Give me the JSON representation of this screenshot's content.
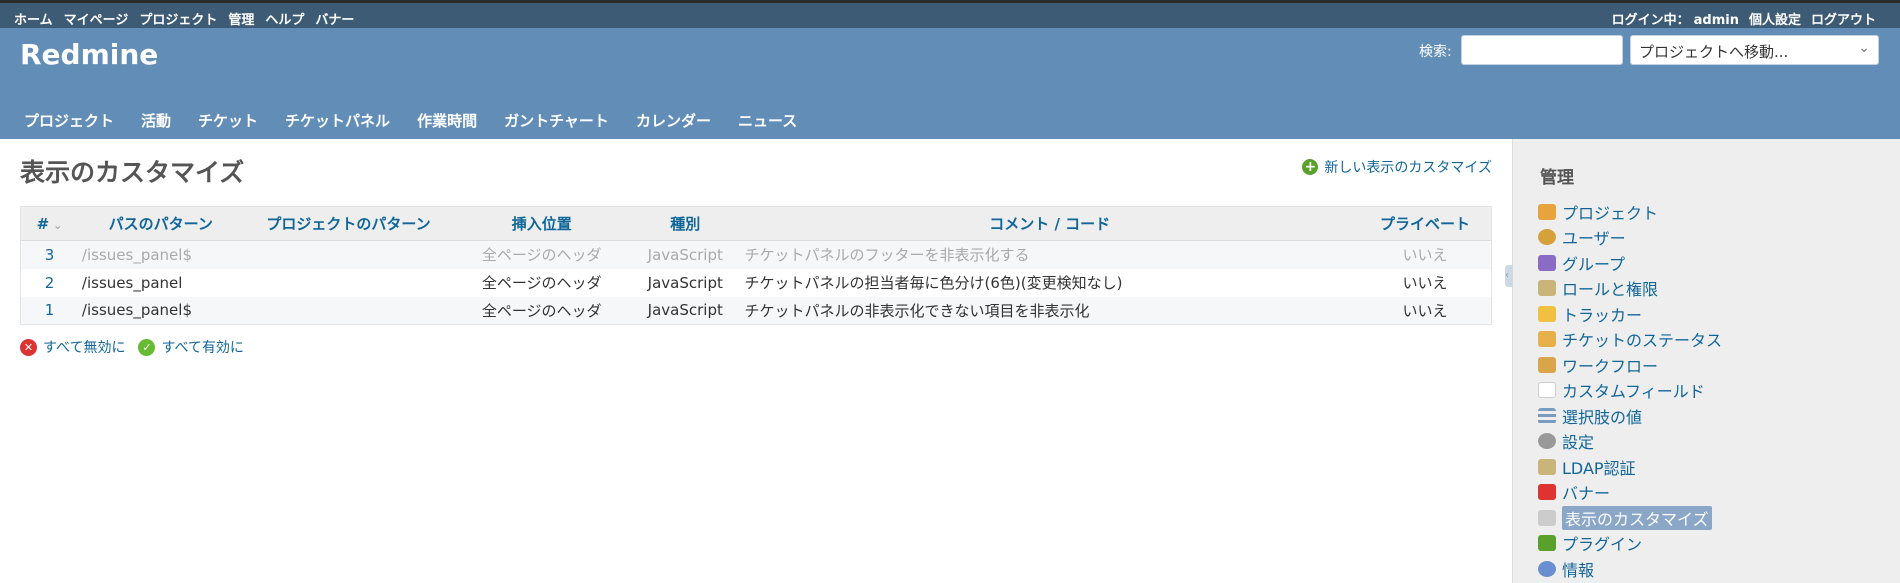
{
  "top_menu": {
    "items": [
      "ホーム",
      "マイページ",
      "プロジェクト",
      "管理",
      "ヘルプ",
      "バナー"
    ],
    "logged_as_label": "ログイン中：",
    "user": "admin",
    "my_account": "個人設定",
    "logout": "ログアウト"
  },
  "header": {
    "title": "Redmine",
    "search_label": "検索:",
    "search_value": "",
    "jump_placeholder": "プロジェクトへ移動..."
  },
  "main_menu": [
    "プロジェクト",
    "活動",
    "チケット",
    "チケットパネル",
    "作業時間",
    "ガントチャート",
    "カレンダー",
    "ニュース"
  ],
  "content": {
    "title": "表示のカスタマイズ",
    "new_link": "新しい表示のカスタマイズ",
    "table": {
      "headers": [
        "#",
        "パスのパターン",
        "プロジェクトのパターン",
        "挿入位置",
        "種別",
        "コメント / コード",
        "プライベート"
      ],
      "rows": [
        {
          "id": "3",
          "path": "/issues_panel$",
          "project": "",
          "position": "全ページのヘッダ",
          "type": "JavaScript",
          "comment": "チケットパネルのフッターを非表示化する",
          "private": "いいえ",
          "disabled": true
        },
        {
          "id": "2",
          "path": "/issues_panel",
          "project": "",
          "position": "全ページのヘッダ",
          "type": "JavaScript",
          "comment": "チケットパネルの担当者毎に色分け(6色)(変更検知なし)",
          "private": "いいえ",
          "disabled": false
        },
        {
          "id": "1",
          "path": "/issues_panel$",
          "project": "",
          "position": "全ページのヘッダ",
          "type": "JavaScript",
          "comment": "チケットパネルの非表示化できない項目を非表示化",
          "private": "いいえ",
          "disabled": false
        }
      ]
    },
    "disable_all": "すべて無効に",
    "enable_all": "すべて有効に"
  },
  "sidebar": {
    "title": "管理",
    "items": [
      {
        "label": "プロジェクト",
        "icon": "projects-icon",
        "color": "#e8a33d"
      },
      {
        "label": "ユーザー",
        "icon": "user-icon",
        "color": "#d6a03a"
      },
      {
        "label": "グループ",
        "icon": "group-icon",
        "color": "#8b6cc4"
      },
      {
        "label": "ロールと権限",
        "icon": "roles-icon",
        "color": "#c9b47a"
      },
      {
        "label": "トラッカー",
        "icon": "tracker-icon",
        "color": "#f0c040"
      },
      {
        "label": "チケットのステータス",
        "icon": "issue-status-icon",
        "color": "#e6b14a"
      },
      {
        "label": "ワークフロー",
        "icon": "workflow-icon",
        "color": "#d9a54a"
      },
      {
        "label": "カスタムフィールド",
        "icon": "custom-fields-icon",
        "color": "#ffffff"
      },
      {
        "label": "選択肢の値",
        "icon": "list-icon",
        "color": "#7a9bc0"
      },
      {
        "label": "設定",
        "icon": "settings-gear-icon",
        "color": "#999999"
      },
      {
        "label": "LDAP認証",
        "icon": "ldap-icon",
        "color": "#c9b47a"
      },
      {
        "label": "バナー",
        "icon": "banner-icon",
        "color": "#d33333"
      },
      {
        "label": "表示のカスタマイズ",
        "icon": "view-customize-icon",
        "color": "#cccccc",
        "selected": true
      },
      {
        "label": "プラグイン",
        "icon": "plugin-icon",
        "color": "#5aa02c"
      },
      {
        "label": "情報",
        "icon": "info-icon",
        "color": "#6a8fd0"
      }
    ]
  }
}
